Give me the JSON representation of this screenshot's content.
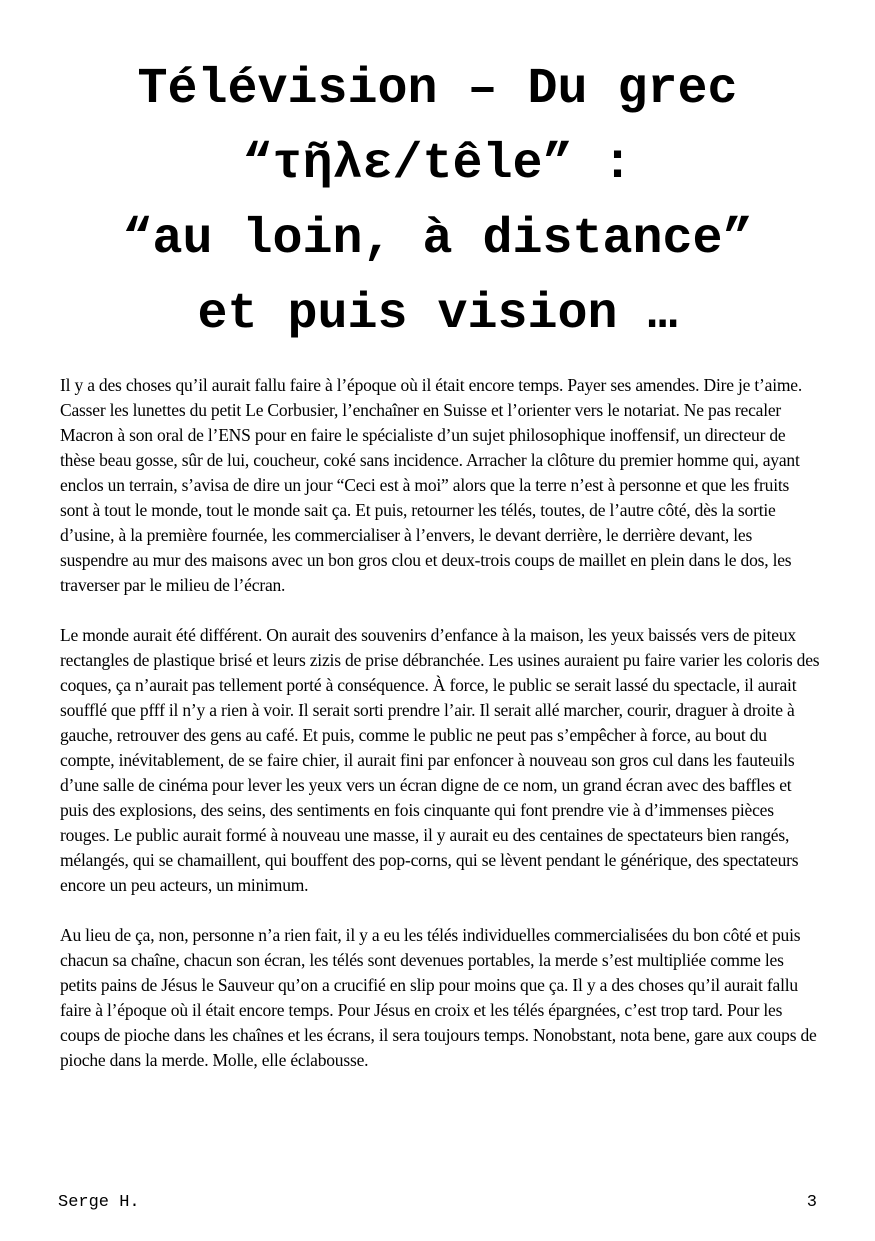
{
  "title": {
    "line1": "Télévision – Du grec",
    "line2": "“τῆλε/têle” :",
    "line3": "“au loin, à distance”",
    "line4": "et puis vision …"
  },
  "paragraphs": [
    "Il y a des choses qu’il aurait fallu faire à l’époque où il était encore temps. Payer ses amendes. Dire je t’aime. Casser les lunettes du petit Le Corbusier, l’enchaîner en Suisse et l’orienter vers le notariat. Ne pas recaler Macron à son oral de l’ENS pour en faire le spécialiste d’un sujet philosophique inoffensif, un directeur de thèse beau gosse, sûr de lui, coucheur, coké sans incidence. Arracher la clôture du premier homme qui, ayant enclos un terrain, s’avisa de dire un jour “Ceci est à moi” alors que la terre n’est à personne et que les fruits sont à tout le monde, tout le monde sait ça. Et puis, retourner les télés, toutes, de l’autre côté, dès la sortie d’usine, à la première fournée, les commercialiser à l’envers, le devant derrière, le derrière devant, les suspendre au mur des maisons avec un bon gros clou et deux-trois coups de maillet en plein dans le dos, les traverser par le milieu de l’écran.",
    "Le monde aurait été différent. On aurait des souvenirs d’enfance à la maison, les yeux baissés vers de piteux rectangles de plastique brisé et leurs zizis de prise débranchée. Les usines auraient pu faire varier les coloris des coques, ça n’aurait pas tellement porté à conséquence. À force, le public se serait lassé du spectacle, il aurait soufflé que pfff il n’y a rien à voir. Il serait sorti prendre l’air. Il serait allé marcher, courir, draguer à droite à gauche, retrouver des gens au café. Et puis, comme le public ne peut pas s’empêcher à force, au bout du compte, inévitablement, de se faire chier, il aurait fini par enfoncer à nouveau son gros cul dans les fauteuils d’une salle de cinéma pour lever les yeux vers un écran digne de ce nom, un grand écran avec des baffles et puis des explosions, des seins, des sentiments en fois cinquante qui font prendre vie à d’immenses pièces rouges. Le public aurait formé à nouveau une masse, il y aurait eu des centaines de spectateurs bien rangés, mélangés, qui se chamaillent, qui bouffent des pop-corns, qui se lèvent pendant le générique, des spectateurs encore un peu acteurs, un minimum.",
    "Au lieu de ça, non, personne n’a rien fait, il y a eu les télés individuelles commercialisées du bon côté et puis chacun sa chaîne, chacun son écran, les télés sont devenues portables, la merde s’est multipliée comme les petits pains de Jésus le Sauveur qu’on a crucifié en slip pour moins que ça. Il y a des choses qu’il aurait fallu faire à l’époque où il était encore temps. Pour Jésus en croix et les télés épargnées, c’est trop tard. Pour les coups de pioche dans les chaînes et les écrans, il sera toujours temps. Nonobstant, nota bene, gare aux coups de pioche dans la merde. Molle, elle éclabousse."
  ],
  "footer": {
    "author": "Serge H.",
    "page_number": "3"
  }
}
